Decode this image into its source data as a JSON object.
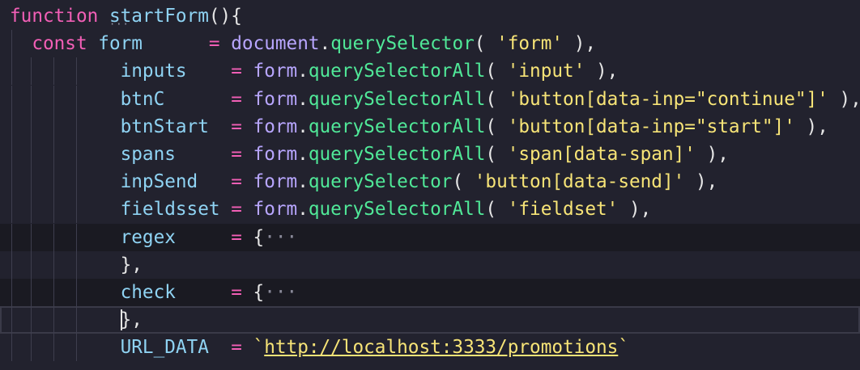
{
  "editor": {
    "lines": [
      {
        "tokens": [
          {
            "t": "function",
            "c": "kw"
          },
          {
            "t": " ",
            "c": "punc"
          },
          {
            "t": "startForm",
            "c": "fn"
          },
          {
            "t": "(){",
            "c": "punc"
          }
        ]
      },
      {
        "tokens": [
          {
            "t": "  ",
            "c": "punc"
          },
          {
            "t": "const",
            "c": "kw"
          },
          {
            "t": " ",
            "c": "punc"
          },
          {
            "t": "form",
            "c": "id"
          },
          {
            "t": "      ",
            "c": "punc"
          },
          {
            "t": "=",
            "c": "op"
          },
          {
            "t": " ",
            "c": "punc"
          },
          {
            "t": "document",
            "c": "doc"
          },
          {
            "t": ".",
            "c": "punc"
          },
          {
            "t": "querySelector",
            "c": "meth"
          },
          {
            "t": "( ",
            "c": "punc"
          },
          {
            "t": "'form'",
            "c": "str"
          },
          {
            "t": " ),",
            "c": "punc"
          }
        ]
      },
      {
        "tokens": [
          {
            "t": "          ",
            "c": "punc"
          },
          {
            "t": "inputs",
            "c": "id"
          },
          {
            "t": "    ",
            "c": "punc"
          },
          {
            "t": "=",
            "c": "op"
          },
          {
            "t": " ",
            "c": "punc"
          },
          {
            "t": "form",
            "c": "doc"
          },
          {
            "t": ".",
            "c": "punc"
          },
          {
            "t": "querySelectorAll",
            "c": "meth"
          },
          {
            "t": "( ",
            "c": "punc"
          },
          {
            "t": "'input'",
            "c": "str"
          },
          {
            "t": " ),",
            "c": "punc"
          }
        ]
      },
      {
        "tokens": [
          {
            "t": "          ",
            "c": "punc"
          },
          {
            "t": "btnC",
            "c": "id"
          },
          {
            "t": "      ",
            "c": "punc"
          },
          {
            "t": "=",
            "c": "op"
          },
          {
            "t": " ",
            "c": "punc"
          },
          {
            "t": "form",
            "c": "doc"
          },
          {
            "t": ".",
            "c": "punc"
          },
          {
            "t": "querySelectorAll",
            "c": "meth"
          },
          {
            "t": "( ",
            "c": "punc"
          },
          {
            "t": "'button[data-inp=\"continue\"]'",
            "c": "str"
          },
          {
            "t": " ),",
            "c": "punc"
          }
        ]
      },
      {
        "tokens": [
          {
            "t": "          ",
            "c": "punc"
          },
          {
            "t": "btnStart",
            "c": "id"
          },
          {
            "t": "  ",
            "c": "punc"
          },
          {
            "t": "=",
            "c": "op"
          },
          {
            "t": " ",
            "c": "punc"
          },
          {
            "t": "form",
            "c": "doc"
          },
          {
            "t": ".",
            "c": "punc"
          },
          {
            "t": "querySelectorAll",
            "c": "meth"
          },
          {
            "t": "( ",
            "c": "punc"
          },
          {
            "t": "'button[data-inp=\"start\"]'",
            "c": "str"
          },
          {
            "t": " ),",
            "c": "punc"
          }
        ]
      },
      {
        "tokens": [
          {
            "t": "          ",
            "c": "punc"
          },
          {
            "t": "spans",
            "c": "id"
          },
          {
            "t": "     ",
            "c": "punc"
          },
          {
            "t": "=",
            "c": "op"
          },
          {
            "t": " ",
            "c": "punc"
          },
          {
            "t": "form",
            "c": "doc"
          },
          {
            "t": ".",
            "c": "punc"
          },
          {
            "t": "querySelectorAll",
            "c": "meth"
          },
          {
            "t": "( ",
            "c": "punc"
          },
          {
            "t": "'span[data-span]'",
            "c": "str"
          },
          {
            "t": " ),",
            "c": "punc"
          }
        ]
      },
      {
        "tokens": [
          {
            "t": "          ",
            "c": "punc"
          },
          {
            "t": "inpSend",
            "c": "id"
          },
          {
            "t": "   ",
            "c": "punc"
          },
          {
            "t": "=",
            "c": "op"
          },
          {
            "t": " ",
            "c": "punc"
          },
          {
            "t": "form",
            "c": "doc"
          },
          {
            "t": ".",
            "c": "punc"
          },
          {
            "t": "querySelector",
            "c": "meth"
          },
          {
            "t": "( ",
            "c": "punc"
          },
          {
            "t": "'button[data-send]'",
            "c": "str"
          },
          {
            "t": " ),",
            "c": "punc"
          }
        ]
      },
      {
        "tokens": [
          {
            "t": "          ",
            "c": "punc"
          },
          {
            "t": "fieldsset",
            "c": "id"
          },
          {
            "t": " ",
            "c": "punc"
          },
          {
            "t": "=",
            "c": "op"
          },
          {
            "t": " ",
            "c": "punc"
          },
          {
            "t": "form",
            "c": "doc"
          },
          {
            "t": ".",
            "c": "punc"
          },
          {
            "t": "querySelectorAll",
            "c": "meth"
          },
          {
            "t": "( ",
            "c": "punc"
          },
          {
            "t": "'fieldset'",
            "c": "str"
          },
          {
            "t": " ),",
            "c": "punc"
          }
        ]
      },
      {
        "folded": true,
        "tokens": [
          {
            "t": "          ",
            "c": "punc"
          },
          {
            "t": "regex",
            "c": "id"
          },
          {
            "t": "     ",
            "c": "punc"
          },
          {
            "t": "=",
            "c": "op"
          },
          {
            "t": " ",
            "c": "punc"
          },
          {
            "t": "{",
            "c": "punc"
          },
          {
            "t": "···",
            "c": "fold"
          }
        ]
      },
      {
        "tokens": [
          {
            "t": "          ",
            "c": "punc"
          },
          {
            "t": "},",
            "c": "punc"
          }
        ]
      },
      {
        "folded": true,
        "tokens": [
          {
            "t": "          ",
            "c": "punc"
          },
          {
            "t": "check",
            "c": "id"
          },
          {
            "t": "     ",
            "c": "punc"
          },
          {
            "t": "=",
            "c": "op"
          },
          {
            "t": " ",
            "c": "punc"
          },
          {
            "t": "{",
            "c": "punc"
          },
          {
            "t": "···",
            "c": "fold"
          }
        ]
      },
      {
        "current": true,
        "tokens": [
          {
            "t": "          ",
            "c": "punc"
          },
          {
            "t": "},",
            "c": "punc"
          }
        ]
      },
      {
        "tokens": [
          {
            "t": "          ",
            "c": "punc"
          },
          {
            "t": "URL_DATA",
            "c": "id"
          },
          {
            "t": "  ",
            "c": "punc"
          },
          {
            "t": "=",
            "c": "op"
          },
          {
            "t": " ",
            "c": "punc"
          },
          {
            "t": "`",
            "c": "str"
          },
          {
            "t": "http://localhost:3333/promotions",
            "c": "url"
          },
          {
            "t": "`",
            "c": "str"
          }
        ]
      }
    ]
  }
}
